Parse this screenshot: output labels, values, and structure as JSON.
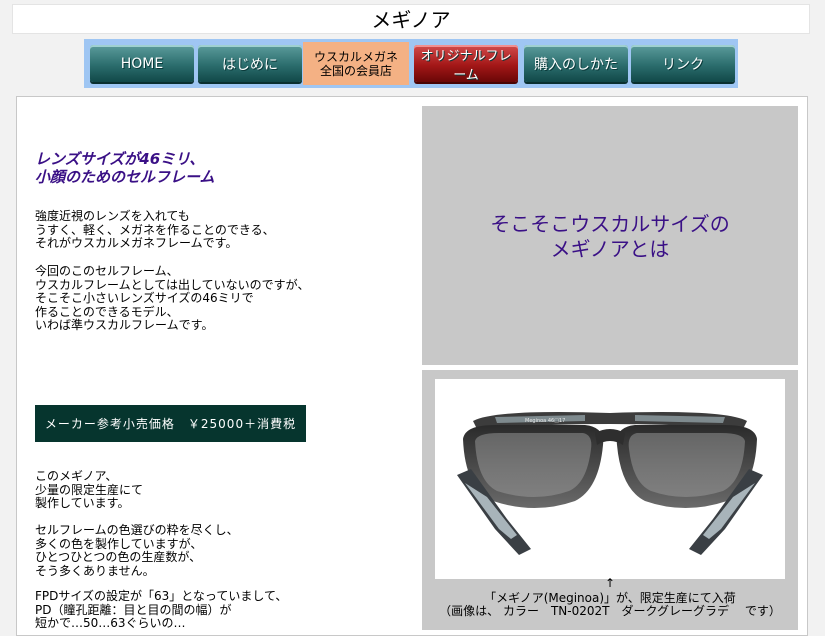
{
  "page": {
    "title": "メギノア"
  },
  "nav": {
    "items": [
      {
        "label": "HOME",
        "style": "teal"
      },
      {
        "label": "はじめに",
        "style": "teal"
      },
      {
        "label_line1": "ウスカルメガネ",
        "label_line2": "全国の会員店",
        "style": "active"
      },
      {
        "label": "オリジナルフレーム",
        "style": "red"
      },
      {
        "label": "購入のしかた",
        "style": "teal"
      },
      {
        "label": "リンク",
        "style": "teal"
      }
    ]
  },
  "left": {
    "subheading": [
      "レンズサイズが46ミリ、",
      "小顔のためのセルフレーム"
    ],
    "paragraph1": [
      "強度近視のレンズを入れても",
      "うすく、軽く、メガネを作ることのできる、",
      "それがウスカルメガネフレームです。"
    ],
    "paragraph2": [
      "今回のこのセルフレーム、",
      "ウスカルフレームとしては出していないのですが、",
      "そこそこ小さいレンズサイズの46ミリで",
      "作ることのできるモデル、",
      "いわば準ウスカルフレームです。"
    ],
    "price": "メーカー参考小売価格　￥25000＋消費税",
    "paragraph3": [
      "このメギノア、",
      "少量の限定生産にて",
      "製作しています。"
    ],
    "paragraph4": [
      "セルフレームの色選びの粋を尽くし、",
      "多くの色を製作していますが、",
      "ひとつひとつの色の生産数が、",
      "そう多くありません。"
    ],
    "paragraph5": [
      "FPDサイズの設定が「63」となっていまして、",
      "PD（瞳孔距離：目と目の間の幅）が",
      "短かで…50…63ぐらいの…"
    ]
  },
  "right": {
    "headline": [
      "そこそこウスカルサイズの",
      "メギノアとは"
    ],
    "arrow": "↑",
    "caption_line1": "「メギノア(Meginoa)」が、限定生産にて入荷",
    "caption_line2": "（画像は、 カラー　TN-0202T　ダークグレーグラデ　 です）",
    "temple_text": "Meginoa 46□17"
  },
  "colors": {
    "accent_purple": "#3a1086",
    "nav_bg": "#9fc6f3",
    "price_bg": "#06352e",
    "active_tab": "#f4b184"
  }
}
